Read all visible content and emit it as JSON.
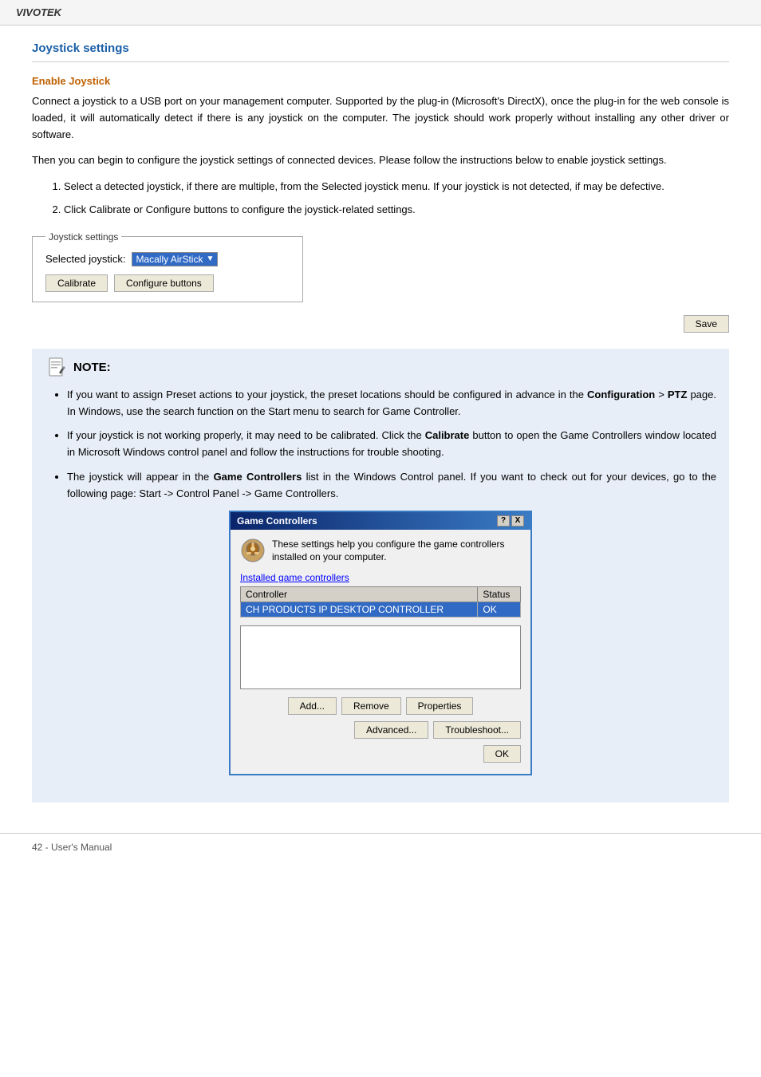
{
  "brand": "VIVOTEK",
  "page": {
    "title": "Joystick settings",
    "section1": {
      "title": "Enable Joystick",
      "paragraph1": "Connect a joystick to a USB port on your management computer. Supported by the plug-in (Microsoft's DirectX), once the plug-in for the web console is loaded, it will automatically detect if there is any joystick on the computer. The joystick should work properly without installing any other driver or software.",
      "paragraph2": "Then you can begin to configure the joystick settings of connected devices. Please follow the instructions below to enable joystick settings.",
      "list": [
        "Select a detected joystick, if there are multiple, from the Selected joystick menu. If your joystick is not detected, if may be defective.",
        "Click Calibrate or Configure buttons to configure the joystick-related settings."
      ]
    }
  },
  "joystick_box": {
    "legend": "Joystick settings",
    "selected_label": "Selected joystick:",
    "selected_value": "Macally AirStick",
    "calibrate_btn": "Calibrate",
    "configure_btn": "Configure buttons"
  },
  "save_btn": "Save",
  "note": {
    "header": "NOTE:",
    "items": [
      "If you want to assign Preset actions to your joystick, the preset locations should be configured in advance in the Configuration > PTZ page. In Windows, use the search function on the Start menu to search for Game Controller.",
      "If your joystick is not working properly, it may need to be calibrated. Click the Calibrate button to open the Game Controllers window located in Microsoft Windows control panel and follow the instructions for trouble shooting.",
      "The joystick will appear in the Game Controllers list in the Windows Control panel. If you want to check out for your devices, go to the following page: Start -> Control Panel -> Game Controllers."
    ],
    "note_item1_bold_config": "Configuration",
    "note_item1_bold_ptz": "PTZ",
    "note_item2_bold": "Calibrate",
    "note_item3_bold": "Game Controllers"
  },
  "game_controllers_dialog": {
    "title": "Game Controllers",
    "help_btn": "?",
    "close_btn": "X",
    "description": "These settings help you configure the game controllers installed on your computer.",
    "installed_label": "Installed game controllers",
    "table": {
      "headers": [
        "Controller",
        "Status"
      ],
      "rows": [
        {
          "controller": "CH PRODUCTS IP DESKTOP CONTROLLER",
          "status": "OK"
        }
      ]
    },
    "add_btn": "Add...",
    "remove_btn": "Remove",
    "properties_btn": "Properties",
    "advanced_btn": "Advanced...",
    "troubleshoot_btn": "Troubleshoot...",
    "ok_btn": "OK"
  },
  "footer": {
    "text": "42 - User's Manual"
  }
}
